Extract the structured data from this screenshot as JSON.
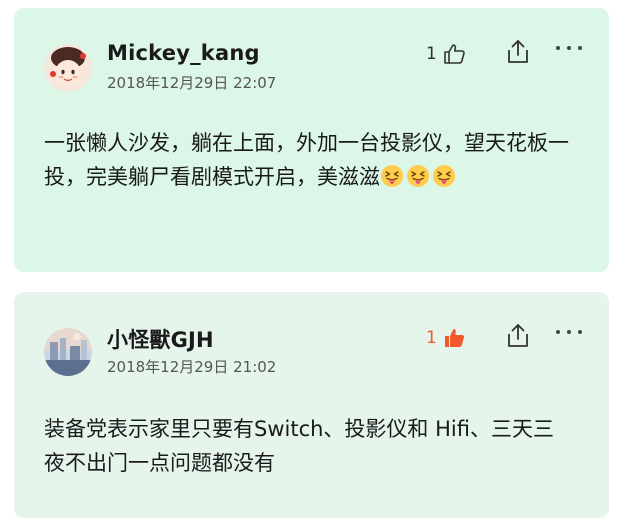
{
  "comments": [
    {
      "username": "Mickey_kang",
      "timestamp": "2018年12月29日 22:07",
      "like_count": "1",
      "liked": false,
      "text": "一张懒人沙发，躺在上面，外加一台投影仪，望天花板一投，完美躺尸看剧模式开启，美滋滋",
      "emojis": [
        "squinting-tongue-emoji",
        "squinting-tongue-emoji",
        "squinting-tongue-emoji"
      ]
    },
    {
      "username": "小怪獸GJH",
      "timestamp": "2018年12月29日 21:02",
      "like_count": "1",
      "liked": true,
      "text": "装备党表示家里只要有Switch、投影仪和 Hifi、三天三夜不出门一点问题都没有"
    }
  ],
  "colors": {
    "card_1_bg": "#dcf6e8",
    "card_2_bg": "#e5f5ec",
    "liked_accent": "#f1592a"
  },
  "icons": {
    "like": "thumbs-up-icon",
    "share": "share-icon",
    "more": "more-icon"
  }
}
